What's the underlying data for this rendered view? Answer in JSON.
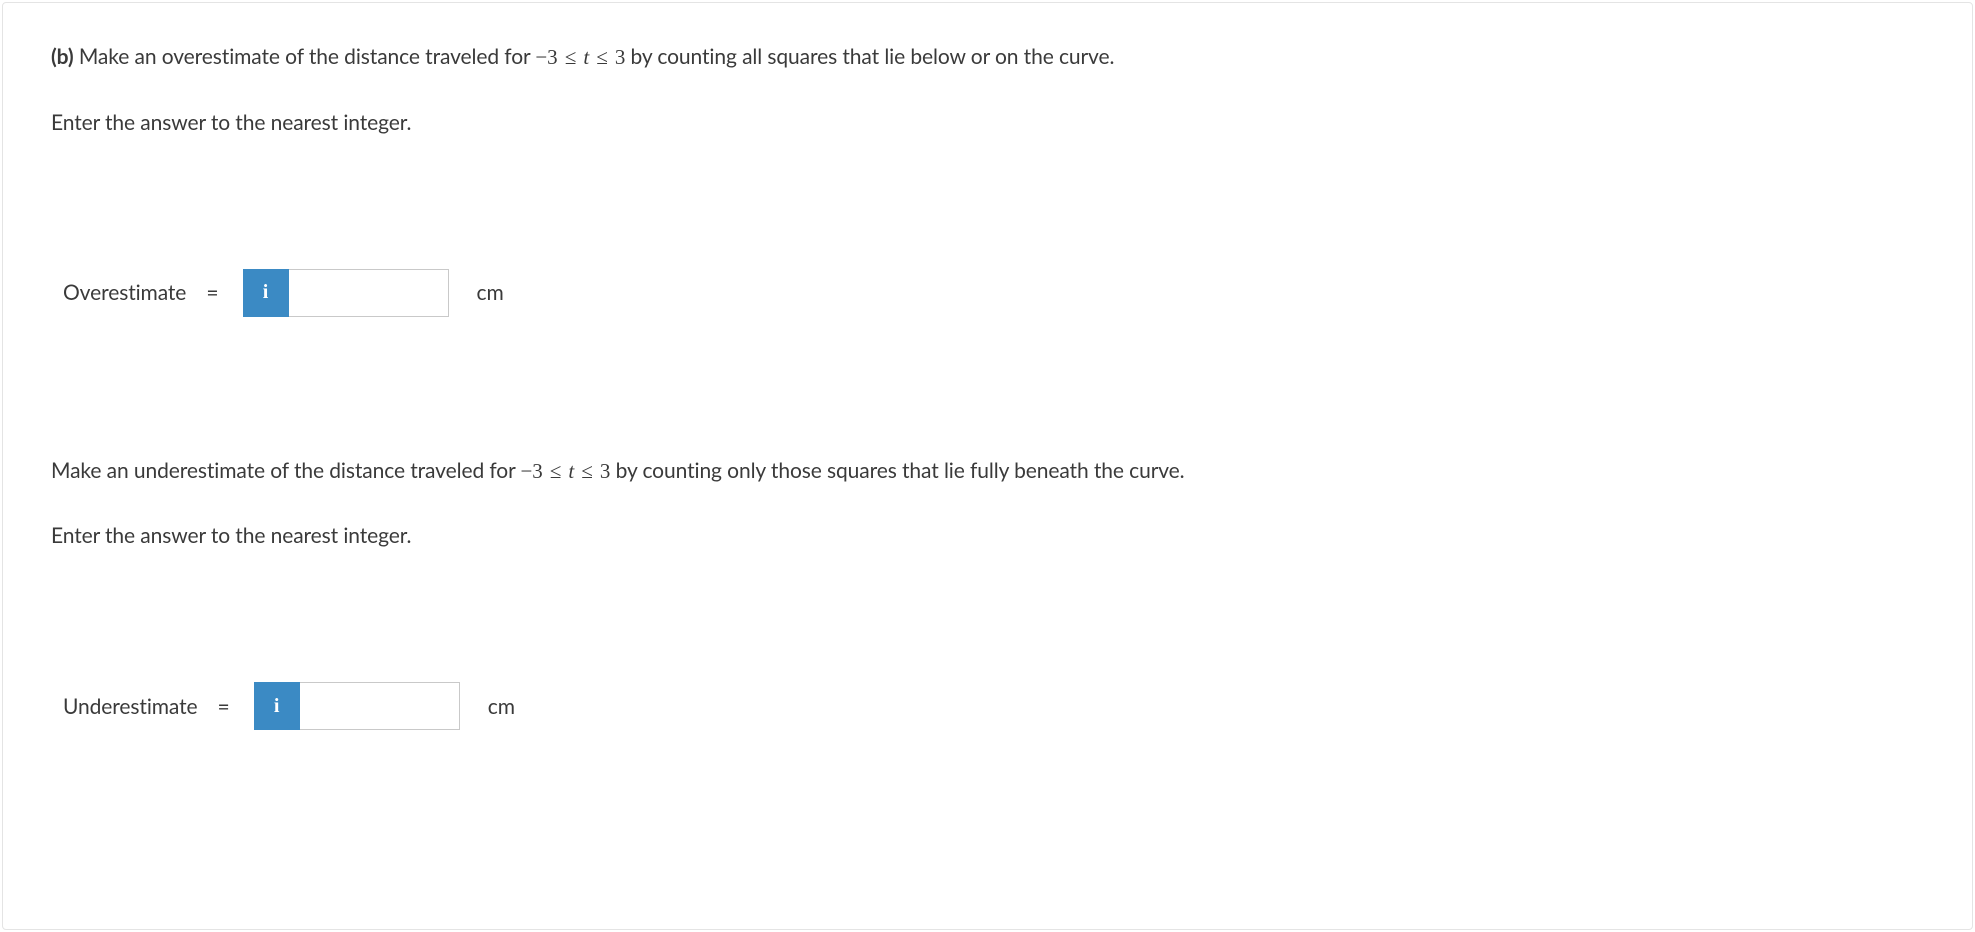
{
  "part_label": "(b)",
  "q1": {
    "prompt_pre": "Make an overestimate of the distance traveled for ",
    "range_a": "−3",
    "range_op": "≤",
    "range_var": "t",
    "range_b": "3",
    "prompt_post": " by counting all squares that lie below or on the curve.",
    "hint": "Enter the answer to the nearest integer.",
    "label": "Overestimate",
    "equals": "=",
    "info_symbol": "i",
    "value": "",
    "unit": "cm"
  },
  "q2": {
    "prompt_pre": "Make an underestimate of the distance traveled for ",
    "range_a": "−3",
    "range_op": "≤",
    "range_var": "t",
    "range_b": "3",
    "prompt_post": " by counting only those squares that lie fully beneath the curve.",
    "hint": "Enter the answer to the nearest integer.",
    "label": "Underestimate",
    "equals": "=",
    "info_symbol": "i",
    "value": "",
    "unit": "cm"
  }
}
